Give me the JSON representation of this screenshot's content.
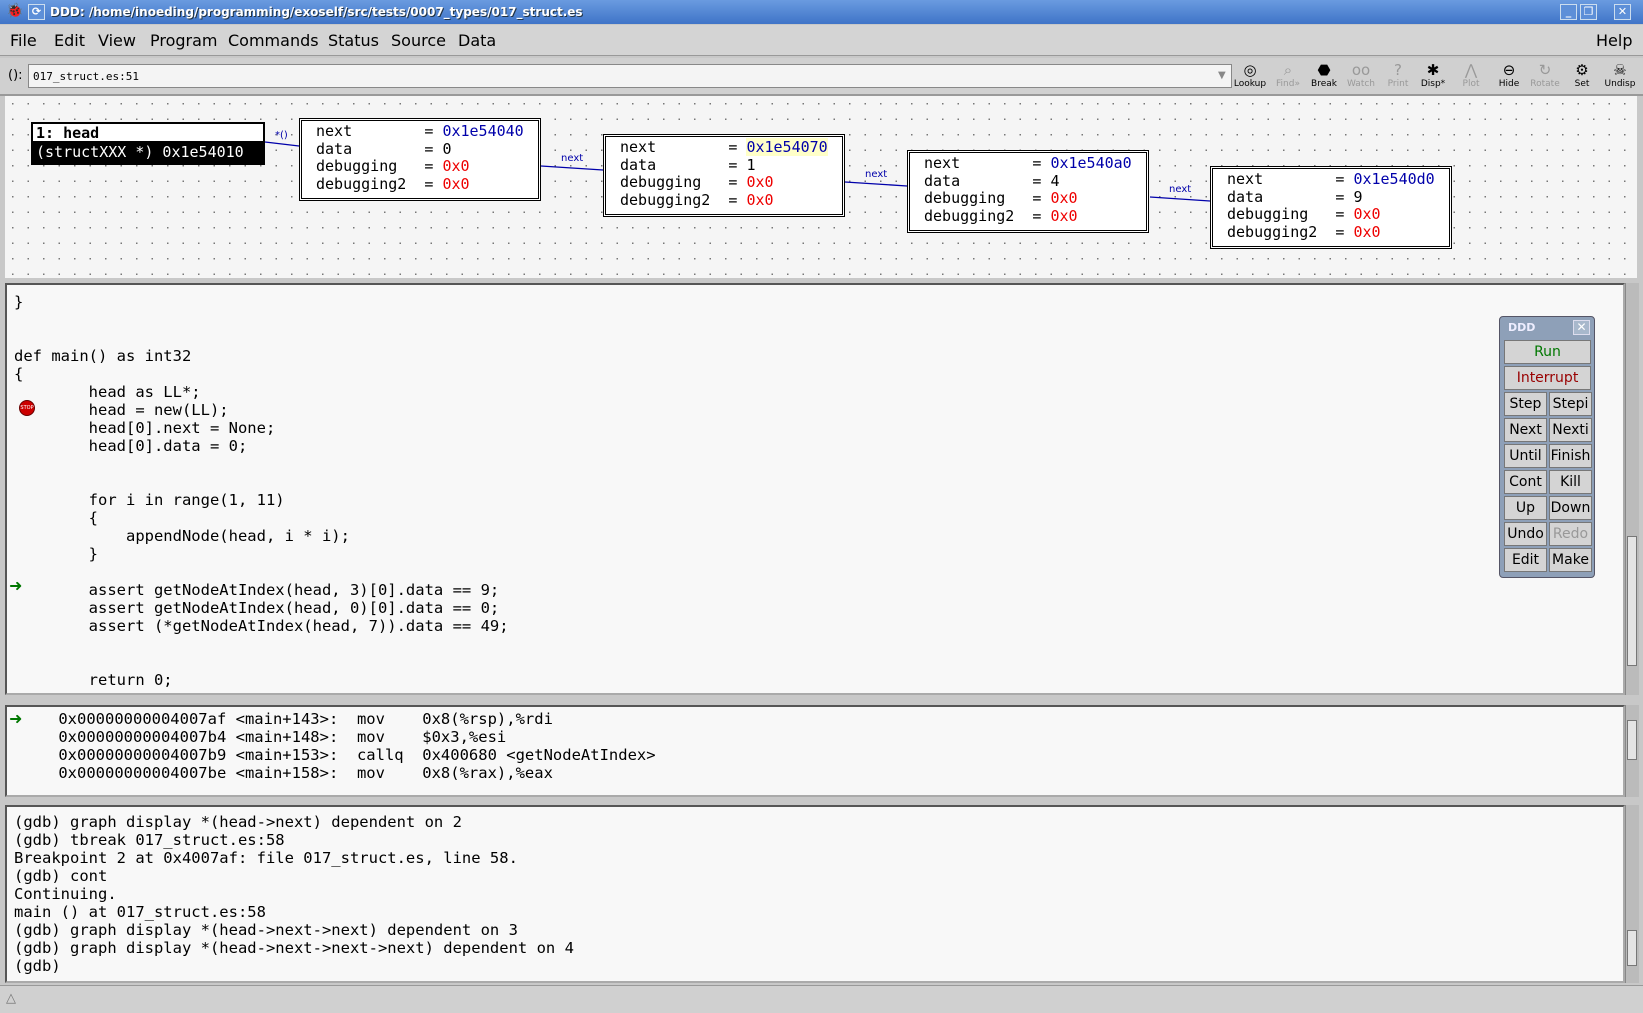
{
  "window": {
    "title": "DDD: /home/inoeding/programming/exoself/src/tests/0007_types/017_struct.es"
  },
  "menu": [
    "File",
    "Edit",
    "View",
    "Program",
    "Commands",
    "Status",
    "Source",
    "Data"
  ],
  "help": "Help",
  "argbar": {
    "label": "():",
    "value": "017_struct.es:51"
  },
  "toolbar": [
    {
      "label": "Lookup",
      "icon": "lookup-icon",
      "glyph": "◎",
      "disabled": false
    },
    {
      "label": "Find»",
      "icon": "find-icon",
      "glyph": "⌕",
      "disabled": true
    },
    {
      "label": "Break",
      "icon": "stop-icon",
      "glyph": "⬣",
      "disabled": false
    },
    {
      "label": "Watch",
      "icon": "watch-icon",
      "glyph": "oo",
      "disabled": true
    },
    {
      "label": "Print",
      "icon": "print-icon",
      "glyph": "?",
      "disabled": true
    },
    {
      "label": "Disp*",
      "icon": "display-icon",
      "glyph": "✱",
      "disabled": false
    },
    {
      "label": "Plot",
      "icon": "plot-icon",
      "glyph": "⋀",
      "disabled": true
    },
    {
      "label": "Hide",
      "icon": "hide-icon",
      "glyph": "⊖",
      "disabled": false
    },
    {
      "label": "Rotate",
      "icon": "rotate-icon",
      "glyph": "↻",
      "disabled": true
    },
    {
      "label": "Set",
      "icon": "set-icon",
      "glyph": "⚙",
      "disabled": false
    },
    {
      "label": "Undisp",
      "icon": "undisplay-icon",
      "glyph": "☠",
      "disabled": false
    }
  ],
  "graph": {
    "head": {
      "title": "1: head",
      "value": "(structXXX *) 0x1e54010",
      "edge": "*()"
    },
    "edge_label": "next",
    "nodes": [
      {
        "next": "0x1e54040",
        "data": "0",
        "debugging": "0x0",
        "debugging2": "0x0"
      },
      {
        "next": "0x1e54070",
        "data": "1",
        "debugging": "0x0",
        "debugging2": "0x0"
      },
      {
        "next": "0x1e540a0",
        "data": "4",
        "debugging": "0x0",
        "debugging2": "0x0"
      },
      {
        "next": "0x1e540d0",
        "data": "9",
        "debugging": "0x0",
        "debugging2": "0x0"
      }
    ],
    "field_labels": [
      "next        =",
      "data        =",
      "debugging   =",
      "debugging2  ="
    ],
    "highlight_color": "#ffffc8"
  },
  "source": [
    "}",
    "",
    "",
    "def main() as int32",
    "{",
    "        head as LL*;",
    "        head = new(LL);",
    "        head[0].next = None;",
    "        head[0].data = 0;",
    "",
    "",
    "        for i in range(1, 11)",
    "        {",
    "            appendNode(head, i * i);",
    "        }",
    "",
    "        assert getNodeAtIndex(head, 3)[0].data == 9;",
    "        assert getNodeAtIndex(head, 0)[0].data == 0;",
    "        assert (*getNodeAtIndex(head, 7)).data == 49;",
    "",
    "",
    "        return 0;"
  ],
  "asm": [
    "    0x00000000004007af <main+143>:  mov    0x8(%rsp),%rdi",
    "    0x00000000004007b4 <main+148>:  mov    $0x3,%esi",
    "    0x00000000004007b9 <main+153>:  callq  0x400680 <getNodeAtIndex>",
    "    0x00000000004007be <main+158>:  mov    0x8(%rax),%eax"
  ],
  "console": [
    "(gdb) graph display *(head->next) dependent on 2",
    "(gdb) tbreak 017_struct.es:58",
    "Breakpoint 2 at 0x4007af: file 017_struct.es, line 58.",
    "(gdb) cont",
    "Continuing.",
    "main () at 017_struct.es:58",
    "(gdb) graph display *(head->next->next) dependent on 3",
    "(gdb) graph display *(head->next->next->next) dependent on 4",
    "(gdb) "
  ],
  "ddd_panel": {
    "title": "DDD",
    "buttons": [
      [
        "Run"
      ],
      [
        "Interrupt"
      ],
      [
        "Step",
        "Stepi"
      ],
      [
        "Next",
        "Nexti"
      ],
      [
        "Until",
        "Finish"
      ],
      [
        "Cont",
        "Kill"
      ],
      [
        "Up",
        "Down"
      ],
      [
        "Undo",
        "Redo"
      ],
      [
        "Edit",
        "Make"
      ]
    ],
    "run_color": "#007700",
    "interrupt_color": "#990000",
    "disabled": [
      "Redo"
    ]
  }
}
